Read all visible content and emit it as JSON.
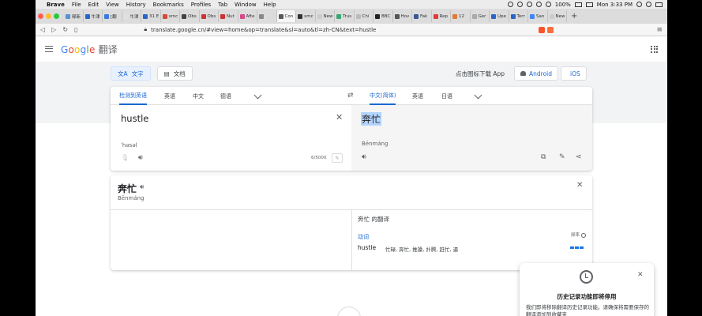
{
  "os_menu": {
    "apple": "",
    "app": "Brave",
    "items": [
      "File",
      "Edit",
      "View",
      "History",
      "Bookmarks",
      "Profiles",
      "Tab",
      "Window",
      "Help"
    ],
    "battery": "100%",
    "clock": "Mon 3:33 PM"
  },
  "browser": {
    "tabs": [
      {
        "label": "释新",
        "color": "#5b8fd6"
      },
      {
        "label": "牛津",
        "color": "#2a66c9"
      },
      {
        "label": "[翻",
        "color": "#3b7be0"
      },
      {
        "label": "牛津",
        "color": "#e0e0e0"
      },
      {
        "label": "31 E",
        "color": "#2a66c9"
      },
      {
        "label": "xmc",
        "color": "#d64a3b"
      },
      {
        "label": "Obs",
        "color": "#444444"
      },
      {
        "label": "Obs",
        "color": "#cc3333"
      },
      {
        "label": "Nut",
        "color": "#cc3333"
      },
      {
        "label": "Afte",
        "color": "#d44a8a"
      },
      {
        "label": "",
        "color": "#888888"
      },
      {
        "label": "Con",
        "color": "#5a5a5a"
      },
      {
        "label": "xmc",
        "color": "#333333"
      },
      {
        "label": "New Tab",
        "color": "#cccccc"
      },
      {
        "label": "Trus",
        "color": "#3aa675"
      },
      {
        "label": "Chi",
        "color": "#bbbbbb"
      },
      {
        "label": "BBC",
        "color": "#222222"
      },
      {
        "label": "Hov",
        "color": "#555555"
      },
      {
        "label": "Fak",
        "color": "#3b5998"
      },
      {
        "label": "Rep",
        "color": "#e03a3a"
      },
      {
        "label": "12",
        "color": "#e07b39"
      },
      {
        "label": "Ger",
        "color": "#aaaaaa"
      },
      {
        "label": "Upe",
        "color": "#2a66c9"
      },
      {
        "label": "Terr",
        "color": "#2a66c9"
      },
      {
        "label": "San",
        "color": "#4285f4"
      },
      {
        "label": "New Tab",
        "color": "#cccccc"
      }
    ],
    "url": "translate.google.cn/#view=home&op=translate&sl=auto&tl=zh-CN&text=hustle"
  },
  "header": {
    "logo_letters": [
      "G",
      "o",
      "o",
      "g",
      "l",
      "e"
    ],
    "product": "翻译"
  },
  "modes": {
    "text": "文字",
    "docs": "文档"
  },
  "app_promo": {
    "hint": "点击图标下载 App",
    "android": "Android",
    "ios": "iOS"
  },
  "source_langs": [
    "检测到英语",
    "英语",
    "中文",
    "德语"
  ],
  "target_langs": [
    "中文(简体)",
    "英语",
    "日语"
  ],
  "source": {
    "text": "hustle",
    "romanization": "ˈhəsəl",
    "count": "6/5000"
  },
  "target": {
    "text": "奔忙",
    "romanization": "Bēnmáng"
  },
  "dictionary": {
    "word": "奔忙",
    "romanization": "Bēnmáng",
    "title": "奔忙 的翻译",
    "pos": "动词",
    "frequency_label": "频率",
    "term": "hustle",
    "translations": "忙碌, 奔忙, 推搡, 扑腾, 赶忙, 逼",
    "frequency": 3
  },
  "history_popup": {
    "title": "历史记录功能即将停用",
    "body": "我们即将移除翻译历史记录功能。请确保将需要保存的翻译添加到收藏夹"
  }
}
